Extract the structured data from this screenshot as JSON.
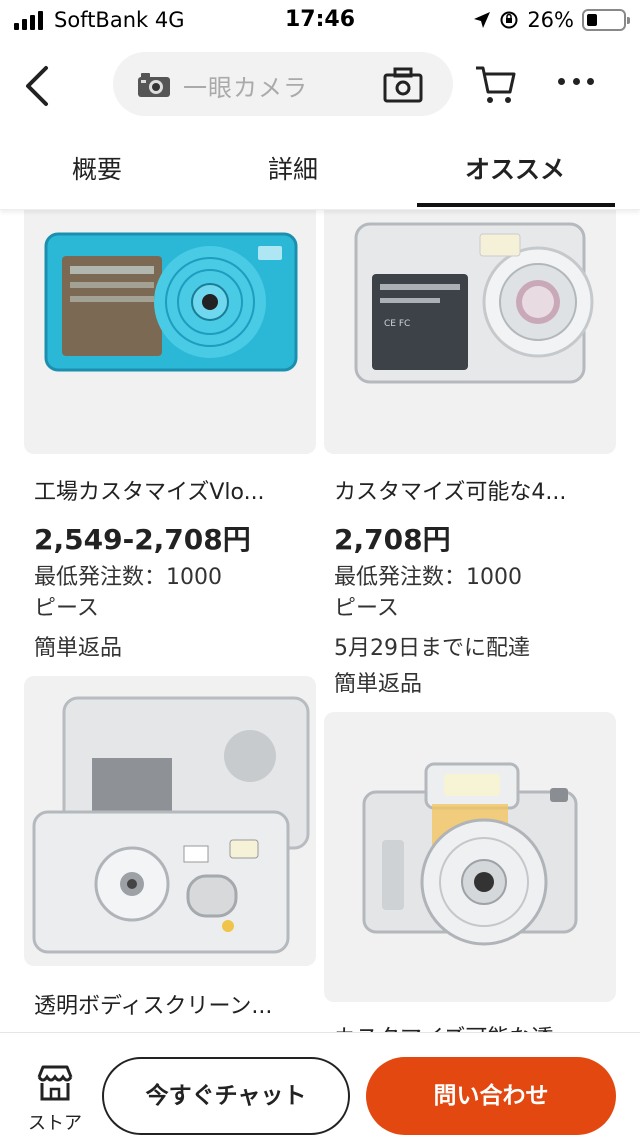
{
  "status_bar": {
    "carrier": "SoftBank  4G",
    "time": "17:46",
    "battery": "26%"
  },
  "header": {
    "search_placeholder": "一眼カメラ",
    "icons": [
      "back-icon",
      "camera-icon",
      "image-search-icon",
      "cart-icon",
      "more-icon"
    ]
  },
  "tabs": [
    {
      "label": "概要"
    },
    {
      "label": "詳細"
    },
    {
      "label": "オススメ",
      "active": true
    }
  ],
  "products": [
    {
      "title": "工場カスタマイズVlo...",
      "price": "2,549-2,708円",
      "moq": "最低発注数：1000",
      "unit": "ピース",
      "notes": [
        "簡単返品"
      ]
    },
    {
      "title": "カスタマイズ可能な4...",
      "price": "2,708円",
      "moq": "最低発注数：1000",
      "unit": "ピース",
      "notes": [
        "5月29日までに配達",
        "簡単返品"
      ]
    },
    {
      "title": "透明ボディスクリーン..."
    },
    {
      "title": "カスタマイズ可能な透..."
    }
  ],
  "bottom_bar": {
    "store_label": "ストア",
    "chat_label": "今すぐチャット",
    "inquiry_label": "問い合わせ"
  },
  "colors": {
    "accent": "#e2480f",
    "camera_teal": "#2bb8d6"
  }
}
